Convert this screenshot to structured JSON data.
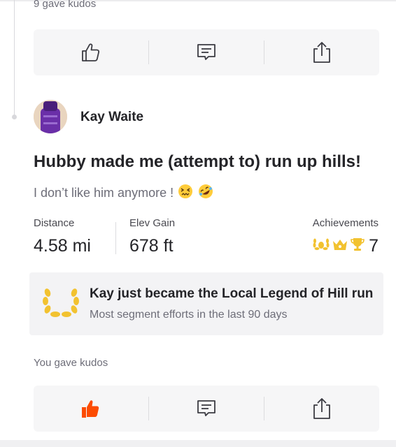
{
  "feed_top": {
    "kudos_text": "9 gave kudos"
  },
  "actions": {
    "kudos_icon": "thumbs-up-icon",
    "comment_icon": "comment-icon",
    "share_icon": "share-icon"
  },
  "activity": {
    "athlete_name": "Kay Waite",
    "title": "Hubby made me (attempt to) run up hills!",
    "description": "I don’t like him anymore !",
    "description_emojis": [
      "😖",
      "🤣"
    ],
    "stats": {
      "distance": {
        "label": "Distance",
        "value": "4.58 mi"
      },
      "elev_gain": {
        "label": "Elev Gain",
        "value": "678 ft"
      },
      "achievements": {
        "label": "Achievements",
        "count": "7",
        "icons": [
          "laurel-icon",
          "crown-icon",
          "trophy-icon"
        ]
      }
    },
    "local_legend": {
      "title": "Kay just became the Local Legend of Hill run",
      "subtitle": "Most segment efforts in the last 90 days"
    },
    "kudos_text": "You gave kudos",
    "kudos_given": true
  },
  "colors": {
    "brand_orange": "#fc4c02",
    "gold": "#f2c230",
    "card_bg": "#f3f3f5"
  }
}
